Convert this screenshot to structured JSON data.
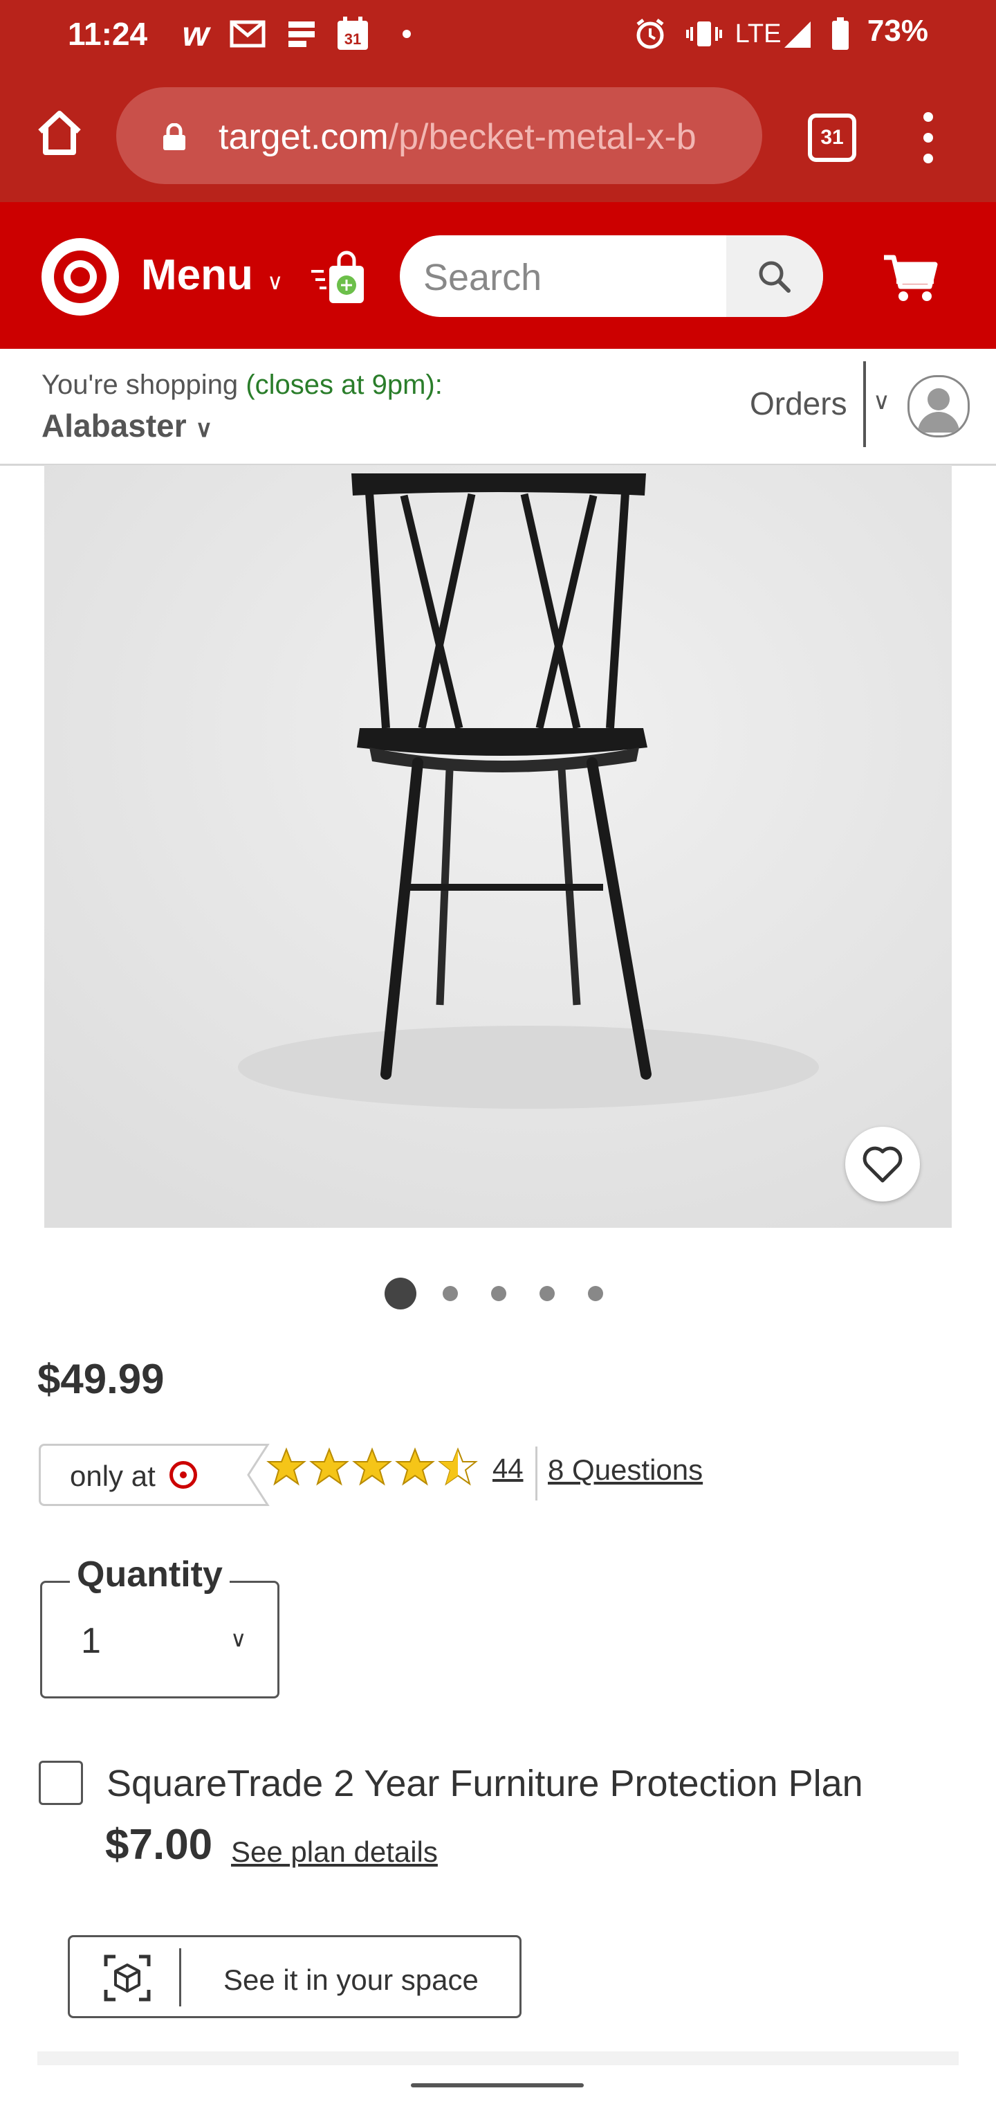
{
  "status_bar": {
    "time": "11:24",
    "calendar_day": "31",
    "network": "LTE",
    "battery": "73%",
    "icons": [
      "w-app-icon",
      "gmail-icon",
      "news-icon",
      "calendar-icon",
      "dot-icon",
      "alarm-icon",
      "vibrate-icon",
      "signal-icon",
      "battery-icon"
    ]
  },
  "browser": {
    "url_host": "target.com",
    "url_path": "/p/becket-metal-x-b",
    "tab_count": "31"
  },
  "header": {
    "menu_label": "Menu",
    "search_placeholder": "Search"
  },
  "store_bar": {
    "shopping_prefix": "You're shopping",
    "closes_text": "(closes at 9pm):",
    "store_name": "Alabaster",
    "orders_label": "Orders"
  },
  "product": {
    "price": "$49.99",
    "only_at_label": "only at",
    "rating": 4.5,
    "review_count": "44",
    "questions_label": "8 Questions",
    "image_count": 5,
    "active_image": 1
  },
  "quantity": {
    "label": "Quantity",
    "value": "1"
  },
  "protection_plan": {
    "title": "SquareTrade 2 Year Furniture Protection Plan",
    "price": "$7.00",
    "link": "See plan details",
    "checked": false
  },
  "ar_button": {
    "label": "See it in your space"
  },
  "colors": {
    "browser_red": "#b8231b",
    "target_red": "#cc0000",
    "closing_green": "#2a7d2a"
  }
}
